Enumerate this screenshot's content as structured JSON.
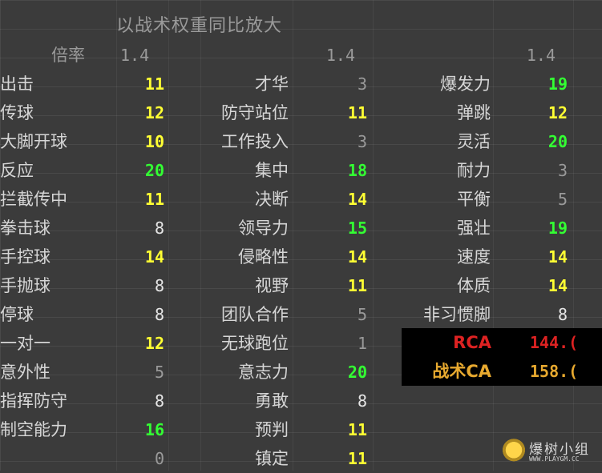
{
  "header": {
    "title": "以战术权重同比放大",
    "ratio_label": "倍率",
    "ratio_col1": "1.4",
    "ratio_col2": "1.4",
    "ratio_col3": "1.4"
  },
  "col1": [
    {
      "label": "出击",
      "value": "11",
      "color": "yellow"
    },
    {
      "label": "传球",
      "value": "12",
      "color": "yellow"
    },
    {
      "label": "大脚开球",
      "value": "10",
      "color": "yellow"
    },
    {
      "label": "反应",
      "value": "20",
      "color": "green"
    },
    {
      "label": "拦截传中",
      "value": "11",
      "color": "yellow"
    },
    {
      "label": "拳击球",
      "value": "8",
      "color": "white"
    },
    {
      "label": "手控球",
      "value": "14",
      "color": "yellow"
    },
    {
      "label": "手抛球",
      "value": "8",
      "color": "white"
    },
    {
      "label": "停球",
      "value": "8",
      "color": "white"
    },
    {
      "label": "一对一",
      "value": "12",
      "color": "yellow"
    },
    {
      "label": "意外性",
      "value": "5",
      "color": "gray"
    },
    {
      "label": "指挥防守",
      "value": "8",
      "color": "white"
    },
    {
      "label": "制空能力",
      "value": "16",
      "color": "green"
    },
    {
      "label": "",
      "value": "0",
      "color": "gray"
    }
  ],
  "col2": [
    {
      "label": "才华",
      "value": "3",
      "color": "gray"
    },
    {
      "label": "防守站位",
      "value": "11",
      "color": "yellow"
    },
    {
      "label": "工作投入",
      "value": "3",
      "color": "gray"
    },
    {
      "label": "集中",
      "value": "18",
      "color": "green"
    },
    {
      "label": "决断",
      "value": "14",
      "color": "yellow"
    },
    {
      "label": "领导力",
      "value": "15",
      "color": "green"
    },
    {
      "label": "侵略性",
      "value": "14",
      "color": "yellow"
    },
    {
      "label": "视野",
      "value": "11",
      "color": "yellow"
    },
    {
      "label": "团队合作",
      "value": "5",
      "color": "gray"
    },
    {
      "label": "无球跑位",
      "value": "1",
      "color": "gray"
    },
    {
      "label": "意志力",
      "value": "20",
      "color": "green"
    },
    {
      "label": "勇敢",
      "value": "8",
      "color": "white"
    },
    {
      "label": "预判",
      "value": "11",
      "color": "yellow"
    },
    {
      "label": "镇定",
      "value": "11",
      "color": "yellow"
    }
  ],
  "col3": [
    {
      "label": "爆发力",
      "value": "19",
      "color": "green"
    },
    {
      "label": "弹跳",
      "value": "12",
      "color": "yellow"
    },
    {
      "label": "灵活",
      "value": "20",
      "color": "green"
    },
    {
      "label": "耐力",
      "value": "3",
      "color": "gray"
    },
    {
      "label": "平衡",
      "value": "5",
      "color": "gray"
    },
    {
      "label": "强壮",
      "value": "19",
      "color": "green"
    },
    {
      "label": "速度",
      "value": "14",
      "color": "yellow"
    },
    {
      "label": "体质",
      "value": "14",
      "color": "yellow"
    },
    {
      "label": "非习惯脚",
      "value": "8",
      "color": "white"
    }
  ],
  "summary": {
    "rca_label": "RCA",
    "rca_value": "144.(",
    "tca_label": "战术CA",
    "tca_value": "158.("
  },
  "watermark": {
    "text": "爆树小组",
    "url": "WWW.PLAYGM.CC",
    "logo_text": "PGS"
  },
  "colors": {
    "yellow": "#ffff33",
    "green": "#33ff33",
    "white": "#e6e6e6",
    "gray": "#9a9a9a",
    "rca": "#dd2222",
    "tca": "#e7a92f",
    "background": "#3b3b3b"
  }
}
